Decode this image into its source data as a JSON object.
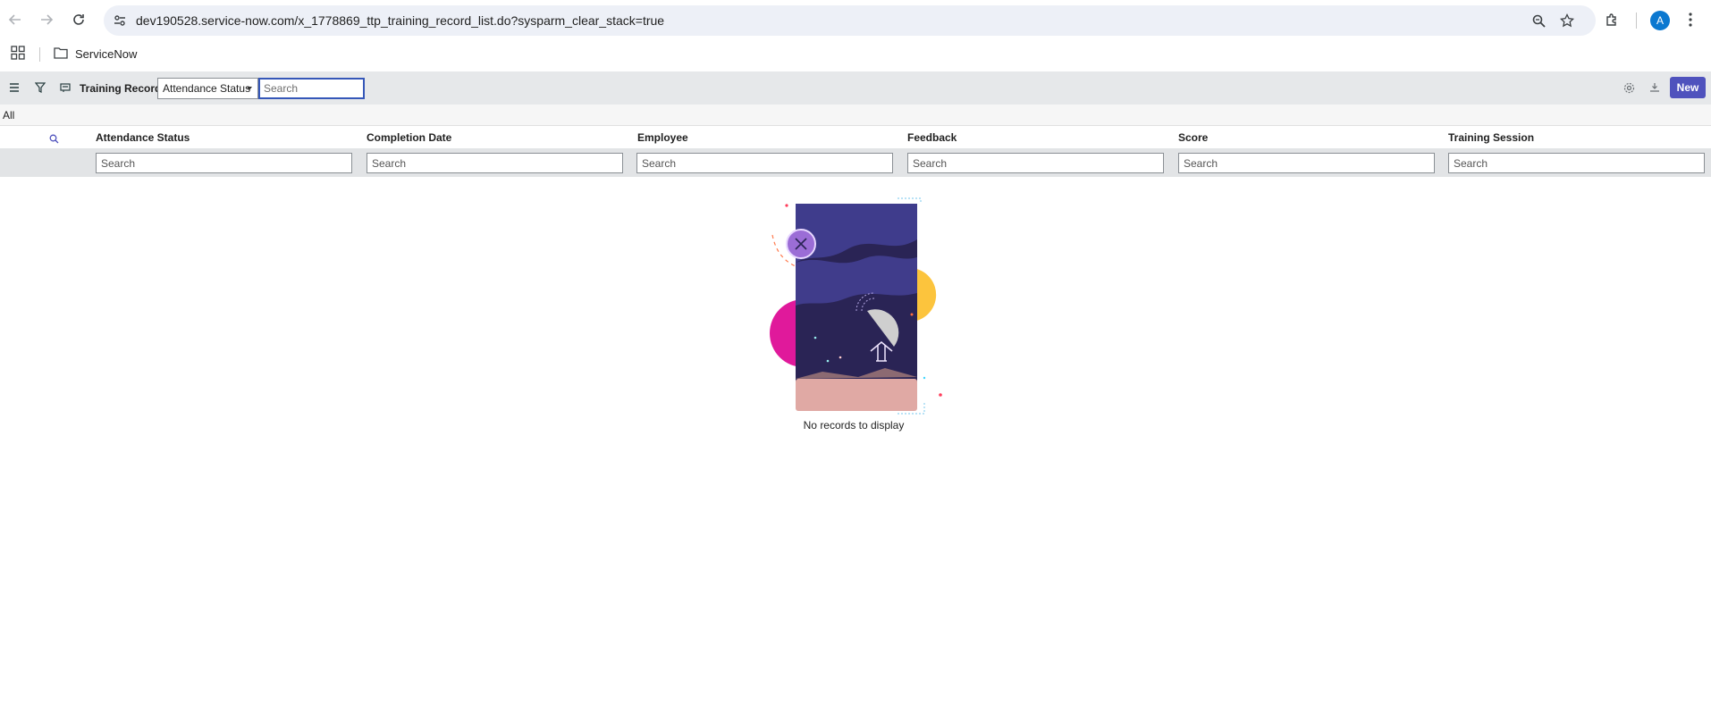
{
  "browser": {
    "url": "dev190528.service-now.com/x_1778869_ttp_training_record_list.do?sysparm_clear_stack=true",
    "profile_initial": "A",
    "bookmarks": [
      {
        "label": "ServiceNow",
        "icon": "folder-icon"
      }
    ]
  },
  "list": {
    "title": "Training Records",
    "search_field": "Attendance Status",
    "search_placeholder": "Search",
    "new_label": "New",
    "breadcrumb": "All",
    "columns": [
      "Attendance Status",
      "Completion Date",
      "Employee",
      "Feedback",
      "Score",
      "Training Session"
    ],
    "column_search_placeholder": "Search",
    "empty_message": "No records to display"
  },
  "colors": {
    "accent": "#4f52bd",
    "toolbar_bg": "#e6e8ea",
    "filter_row_bg": "#e2e4e6"
  }
}
